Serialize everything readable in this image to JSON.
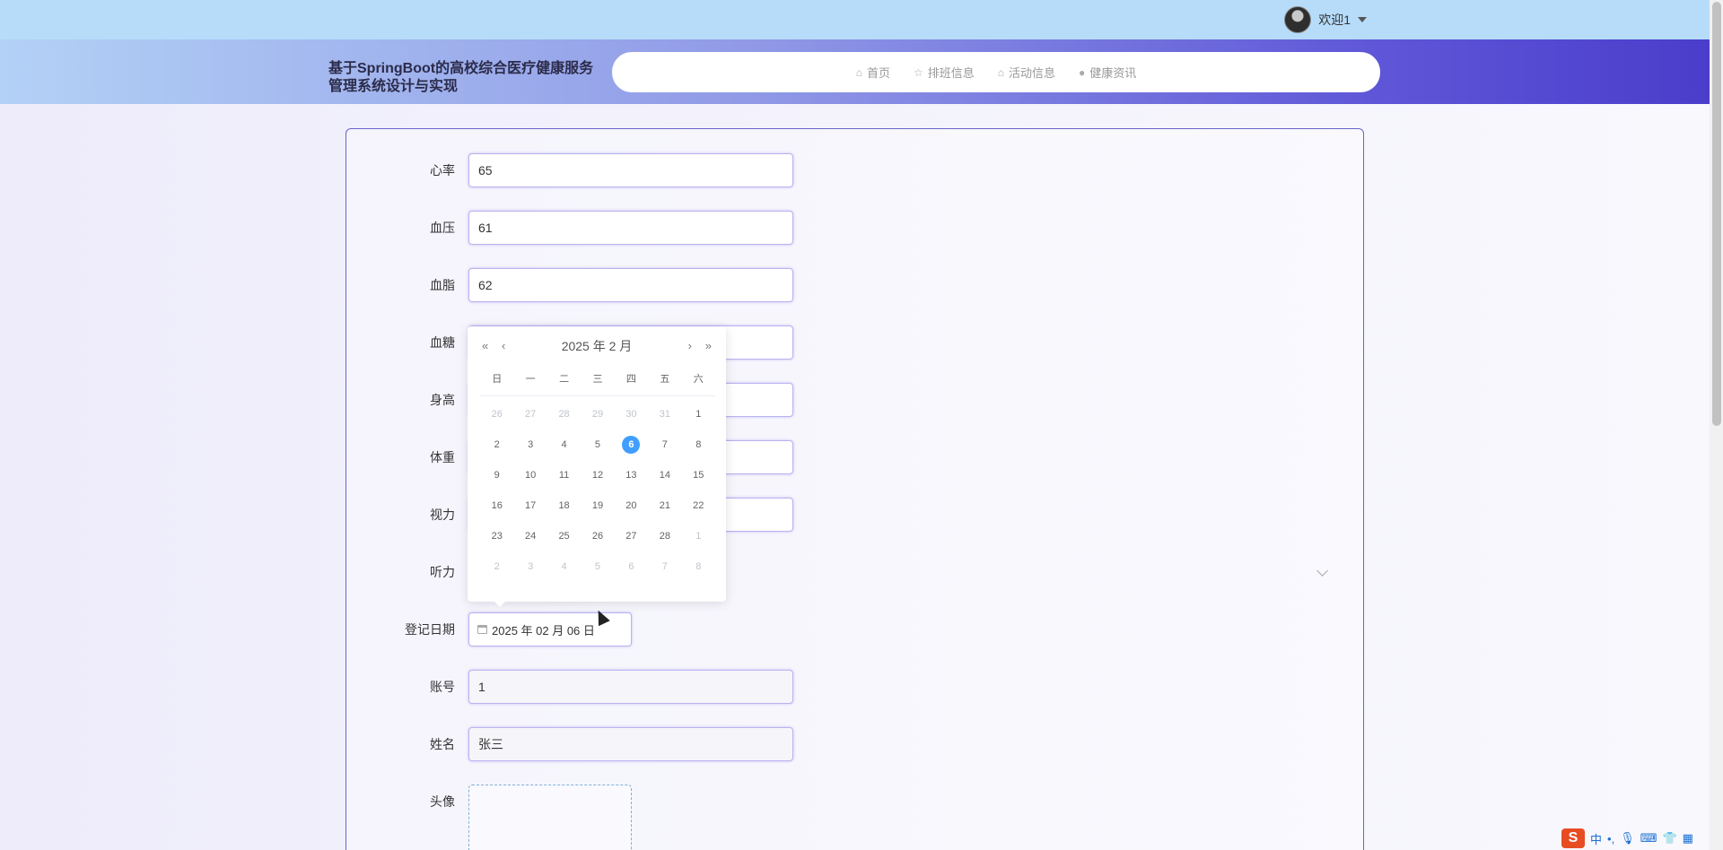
{
  "topbar": {
    "welcome": "欢迎1"
  },
  "header": {
    "title": "基于SpringBoot的高校综合医疗健康服务管理系统设计与实现",
    "nav": [
      {
        "label": "首页",
        "icon": "home-icon"
      },
      {
        "label": "排班信息",
        "icon": "star-icon"
      },
      {
        "label": "活动信息",
        "icon": "bag-icon"
      },
      {
        "label": "健康资讯",
        "icon": "info-icon"
      }
    ]
  },
  "form": {
    "heart_rate": {
      "label": "心率",
      "value": "65"
    },
    "blood_pressure": {
      "label": "血压",
      "value": "61"
    },
    "blood_lipid": {
      "label": "血脂",
      "value": "62"
    },
    "blood_sugar": {
      "label": "血糖"
    },
    "height": {
      "label": "身高"
    },
    "weight": {
      "label": "体重"
    },
    "vision": {
      "label": "视力"
    },
    "hearing": {
      "label": "听力"
    },
    "reg_date": {
      "label": "登记日期",
      "value": "2025 年 02 月 06 日"
    },
    "account": {
      "label": "账号",
      "value": "1"
    },
    "name": {
      "label": "姓名",
      "value": "张三"
    },
    "avatar": {
      "label": "头像"
    }
  },
  "datepicker": {
    "title": "2025 年  2 月",
    "prev_year": "«",
    "prev_month": "‹",
    "next_month": "›",
    "next_year": "»",
    "weekdays": [
      "日",
      "一",
      "二",
      "三",
      "四",
      "五",
      "六"
    ],
    "selected": "6",
    "days": [
      {
        "d": "26",
        "other": true
      },
      {
        "d": "27",
        "other": true
      },
      {
        "d": "28",
        "other": true
      },
      {
        "d": "29",
        "other": true
      },
      {
        "d": "30",
        "other": true
      },
      {
        "d": "31",
        "other": true
      },
      {
        "d": "1"
      },
      {
        "d": "2"
      },
      {
        "d": "3"
      },
      {
        "d": "4"
      },
      {
        "d": "5"
      },
      {
        "d": "6",
        "current": true
      },
      {
        "d": "7"
      },
      {
        "d": "8"
      },
      {
        "d": "9"
      },
      {
        "d": "10"
      },
      {
        "d": "11"
      },
      {
        "d": "12"
      },
      {
        "d": "13"
      },
      {
        "d": "14"
      },
      {
        "d": "15"
      },
      {
        "d": "16"
      },
      {
        "d": "17"
      },
      {
        "d": "18"
      },
      {
        "d": "19"
      },
      {
        "d": "20"
      },
      {
        "d": "21"
      },
      {
        "d": "22"
      },
      {
        "d": "23"
      },
      {
        "d": "24"
      },
      {
        "d": "25"
      },
      {
        "d": "26"
      },
      {
        "d": "27"
      },
      {
        "d": "28"
      },
      {
        "d": "1",
        "other": true
      },
      {
        "d": "2",
        "other": true
      },
      {
        "d": "3",
        "other": true
      },
      {
        "d": "4",
        "other": true
      },
      {
        "d": "5",
        "other": true
      },
      {
        "d": "6",
        "other": true
      },
      {
        "d": "7",
        "other": true
      },
      {
        "d": "8",
        "other": true
      }
    ]
  },
  "ime": {
    "logo": "S",
    "lang": "中"
  },
  "colors": {
    "accent": "#409eff",
    "panel_border": "#6b63c9",
    "topbar": "#b6dcfa"
  }
}
